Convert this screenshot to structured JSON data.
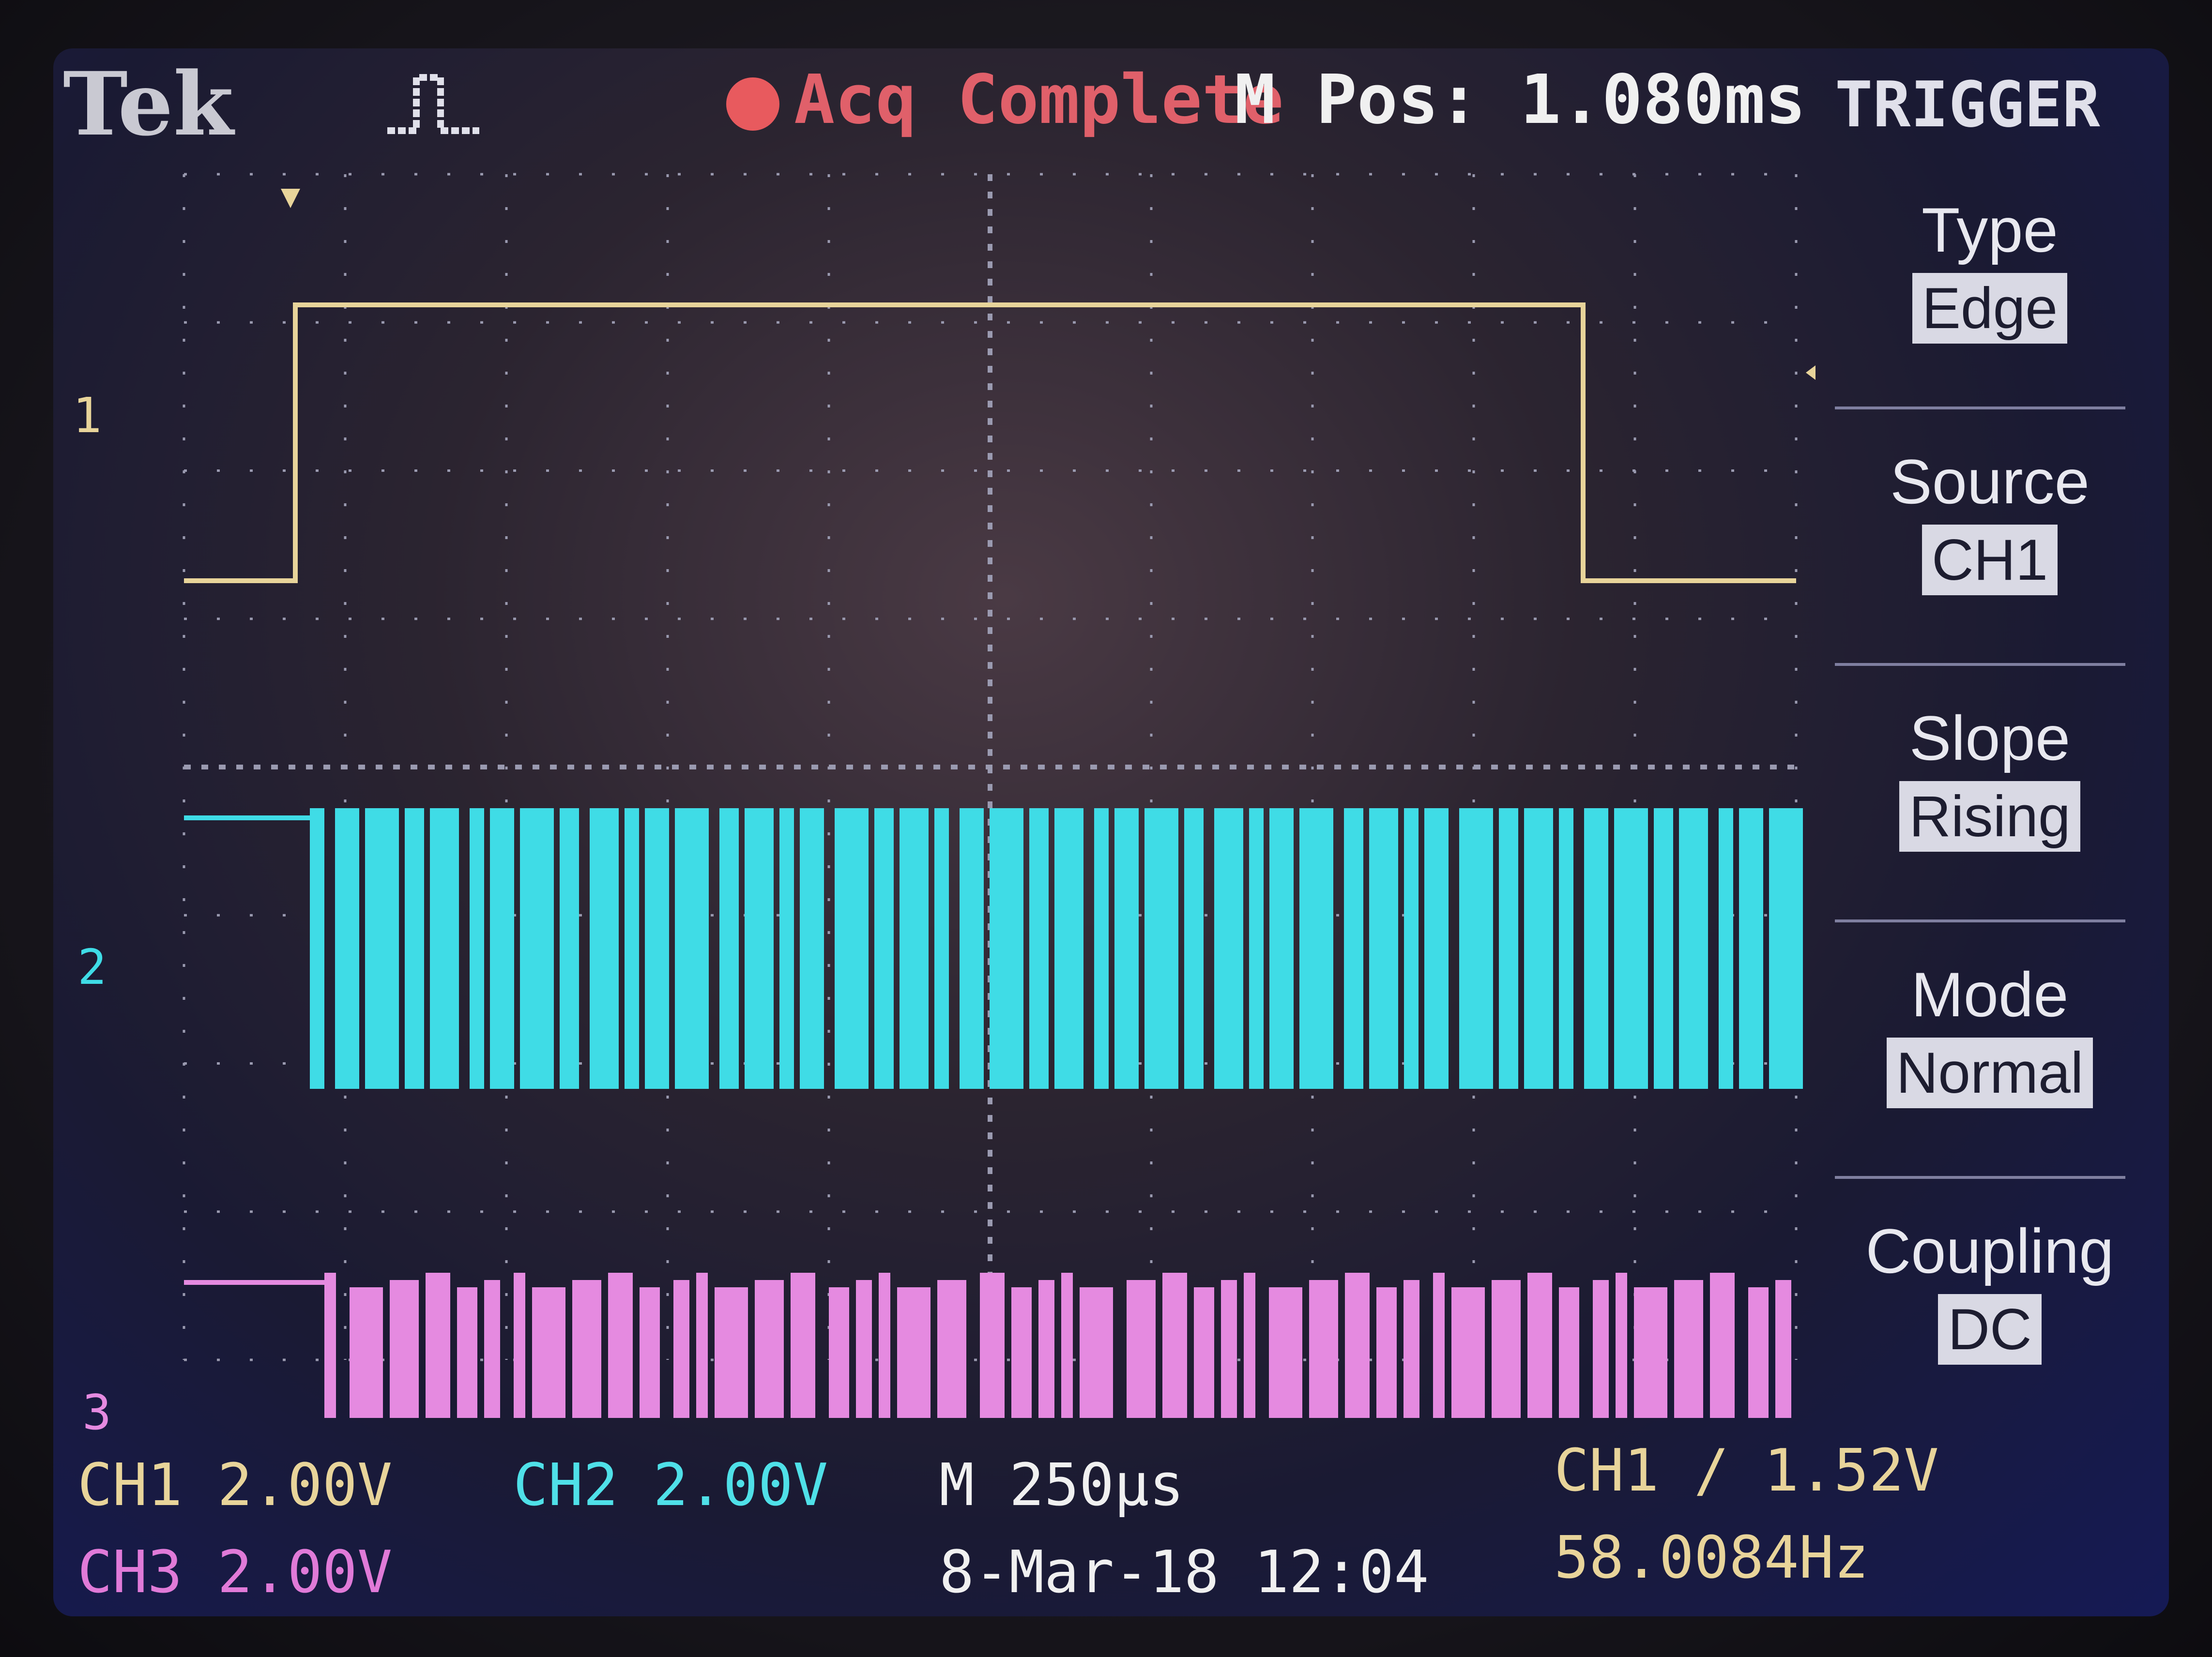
{
  "header": {
    "brand": "Tek",
    "acq_status": "Acq Complete",
    "m_pos": "M Pos: 1.080ms",
    "menu_title": "TRIGGER"
  },
  "trigger_menu": [
    {
      "label": "Type",
      "value": "Edge"
    },
    {
      "label": "Source",
      "value": "CH1"
    },
    {
      "label": "Slope",
      "value": "Rising"
    },
    {
      "label": "Mode",
      "value": "Normal"
    },
    {
      "label": "Coupling",
      "value": "DC"
    }
  ],
  "status": {
    "ch1": "CH1  2.00V",
    "ch2": "CH2  2.00V",
    "ch3": "CH3  2.00V",
    "timebase": "M 250µs",
    "date": "8-Mar-18 12:04",
    "trigger": "CH1 ∕ 1.52V",
    "freq": "58.0084Hz"
  },
  "channel_markers": {
    "ch1": "1",
    "ch2": "2",
    "ch3": "3"
  },
  "colors": {
    "ch1": "#e8d49a",
    "ch2": "#3fdce6",
    "ch3": "#e58ae0",
    "grid": "#9a9ab0",
    "acq": "#e0606a"
  }
}
